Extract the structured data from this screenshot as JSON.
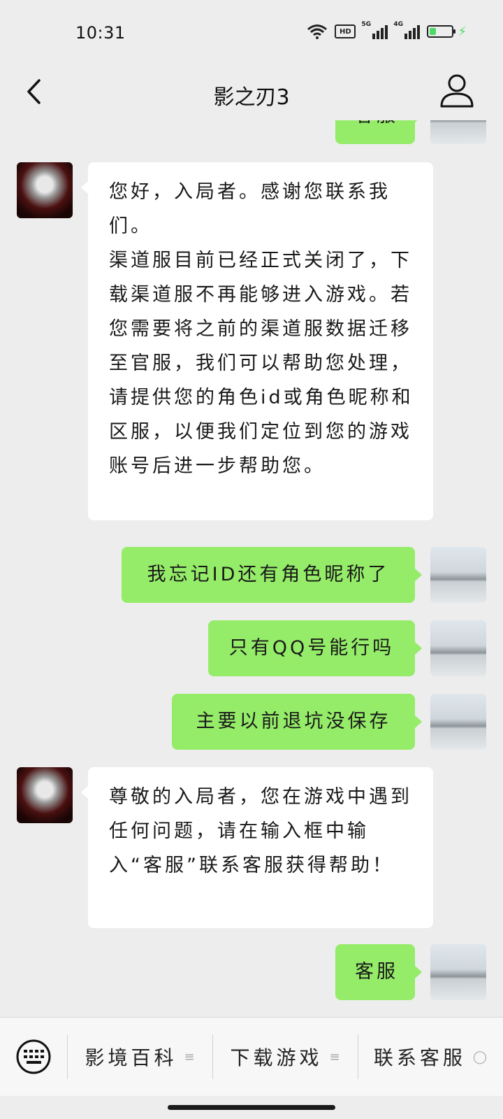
{
  "status": {
    "time": "10:31",
    "hd_label": "HD",
    "net1": "5G",
    "net2": "4G",
    "battery_level": 0.3,
    "icons": [
      "wifi-icon",
      "hd-icon",
      "signal-icon",
      "signal-icon",
      "battery-icon",
      "charging-icon"
    ]
  },
  "header": {
    "title": "影之刃3",
    "back_icon": "chevron-left-icon",
    "profile_icon": "person-outline-icon"
  },
  "chat": {
    "partial_top": {
      "text": "客服"
    },
    "messages": [
      {
        "from": "bot",
        "lines": [
          "您好，入局者。感谢您联系我们。",
          "渠道服目前已经正式关闭了，下载渠道服不再能够进入游戏。若您需要将之前的渠道服数据迁移至官服，我们可以帮助您处理，请提供您的角色id或角色昵称和区服，以便我们定位到您的游戏账号后进一步帮助您。"
        ]
      },
      {
        "from": "user",
        "text": "我忘记ID还有角色昵称了"
      },
      {
        "from": "user",
        "text": "只有QQ号能行吗"
      },
      {
        "from": "user",
        "text": "主要以前退坑没保存"
      },
      {
        "from": "bot",
        "lines": [
          "尊敬的入局者，您在游戏中遇到任何问题，请在输入框中输入“客服”联系客服获得帮助！"
        ]
      },
      {
        "from": "user",
        "text": "客服"
      }
    ]
  },
  "menu": {
    "keyboard_icon": "keyboard-icon",
    "items": [
      {
        "label": "影境百科",
        "glyph": "≡"
      },
      {
        "label": "下载游戏",
        "glyph": "≡"
      },
      {
        "label": "联系客服",
        "glyph": "◯"
      }
    ]
  }
}
